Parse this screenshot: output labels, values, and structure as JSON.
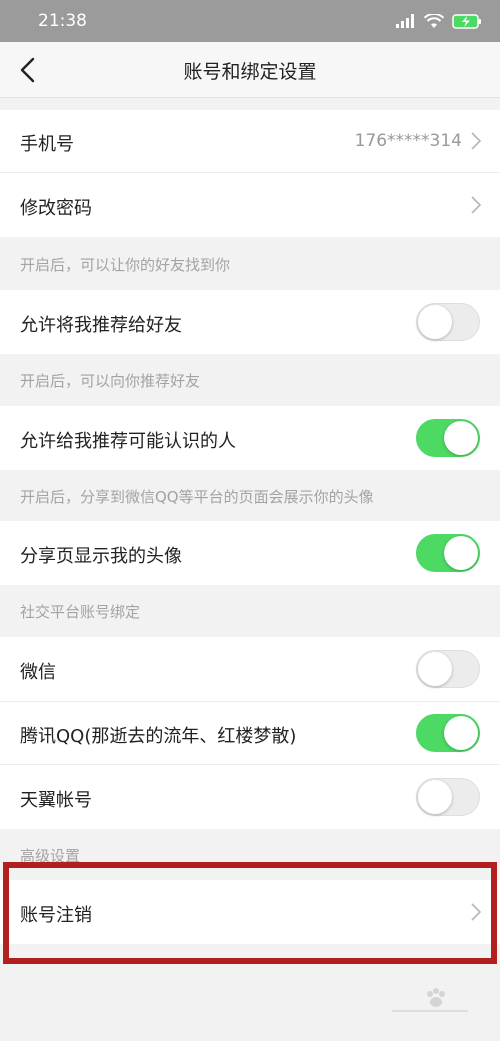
{
  "status_bar": {
    "time": "21:38",
    "signal_icon": "signal-icon",
    "wifi_icon": "wifi-icon",
    "battery_icon": "battery-charging-icon"
  },
  "nav": {
    "title": "账号和绑定设置",
    "back_icon": "back-chevron-icon"
  },
  "account": {
    "phone_label": "手机号",
    "phone_value": "176*****314",
    "password_label": "修改密码"
  },
  "sections": {
    "s1": "开启后，可以让你的好友找到你",
    "s2": "开启后，可以向你推荐好友",
    "s3": "开启后，分享到微信QQ等平台的页面会展示你的头像",
    "s4": "社交平台账号绑定",
    "s5": "高级设置"
  },
  "toggles": {
    "recommend_me": {
      "label": "允许将我推荐给好友",
      "on": false
    },
    "recommend_people": {
      "label": "允许给我推荐可能认识的人",
      "on": true
    },
    "share_avatar": {
      "label": "分享页显示我的头像",
      "on": true
    },
    "wechat": {
      "label": "微信",
      "on": false
    },
    "qq": {
      "label": "腾讯QQ(那逝去的流年、红楼梦散)",
      "on": true
    },
    "tianyi": {
      "label": "天翼帐号",
      "on": false
    }
  },
  "advanced": {
    "cancel_account_label": "账号注销"
  },
  "colors": {
    "toggle_on": "#4cd964",
    "highlight": "#b21f1f",
    "status_bar": "#9b9b9b"
  }
}
